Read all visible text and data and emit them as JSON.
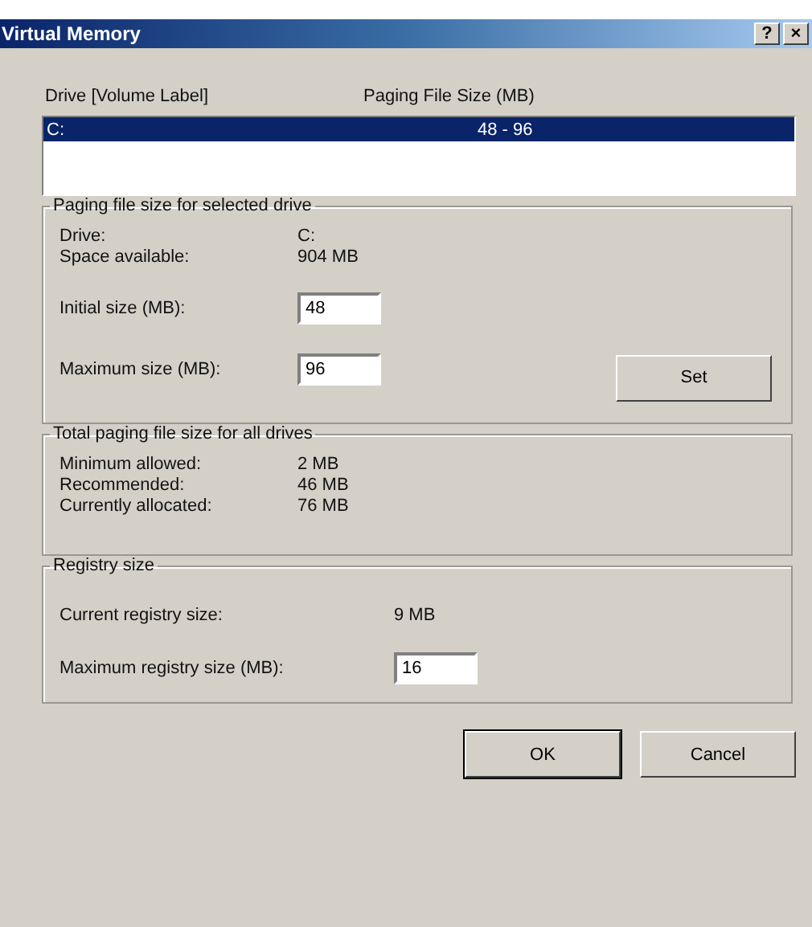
{
  "window": {
    "title": "Virtual Memory",
    "buttons": [
      "?",
      "×"
    ]
  },
  "drive_list": {
    "columns": [
      "Drive  [Volume Label]",
      "Paging File Size (MB)"
    ],
    "rows": [
      {
        "drive": "C:",
        "size": "48 - 96",
        "selected": true
      }
    ]
  },
  "selected_drive": {
    "title": "Paging file size for selected drive",
    "info": [
      {
        "label": "Drive:",
        "value": "C:"
      },
      {
        "label": "Space available:",
        "value": "904 MB"
      }
    ],
    "fields": [
      {
        "label": "Initial size (MB):",
        "value": "48"
      },
      {
        "label": "Maximum size (MB):",
        "value": "96"
      }
    ],
    "set_button": "Set"
  },
  "totals": {
    "title": "Total paging file size for all drives",
    "info": [
      {
        "label": "Minimum allowed:",
        "value": "2 MB"
      },
      {
        "label": "Recommended:",
        "value": "46 MB"
      },
      {
        "label": "Currently allocated:",
        "value": "76 MB"
      }
    ]
  },
  "registry": {
    "title": "Registry size",
    "current_label": "Current registry size:",
    "current_value": "9 MB",
    "max_label": "Maximum registry size (MB):",
    "max_value": "16"
  },
  "buttons": [
    "OK",
    "Cancel"
  ]
}
